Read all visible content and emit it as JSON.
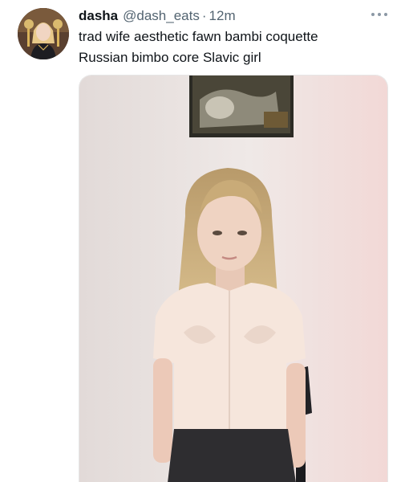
{
  "tweet": {
    "display_name": "dasha",
    "handle": "@dash_eats",
    "separator": "·",
    "time": "12m",
    "text_lines": [
      "trad wife aesthetic fawn bambi coquette",
      "Russian bimbo core Slavic girl"
    ],
    "more_icon": "more-horizontal-icon"
  },
  "colors": {
    "text_primary": "#0f1419",
    "text_secondary": "#536471",
    "icon": "#8b98a5",
    "background": "#ffffff",
    "media_wall": "#ece6e3"
  }
}
